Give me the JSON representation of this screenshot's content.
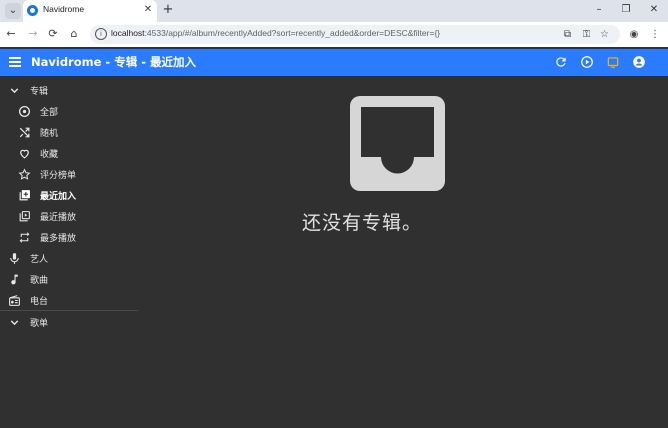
{
  "browser": {
    "tab_title": "Navidrome",
    "tab_close": "✕",
    "new_tab": "+",
    "url_host": "localhost",
    "url_rest": ":4533/app/#/album/recentlyAdded?sort=recently_added&order=DESC&filter={}",
    "window_minimize": "–",
    "window_restore": "❐",
    "window_close": "✕"
  },
  "appbar": {
    "title": "Navidrome - 专辑 - 最近加入"
  },
  "sidebar": {
    "albums_section": "专辑",
    "album_items": [
      {
        "label": "全部",
        "icon": "album-icon"
      },
      {
        "label": "随机",
        "icon": "shuffle-icon"
      },
      {
        "label": "收藏",
        "icon": "heart-icon"
      },
      {
        "label": "评分榜单",
        "icon": "star-icon"
      },
      {
        "label": "最近加入",
        "icon": "library-add-icon",
        "active": true
      },
      {
        "label": "最近播放",
        "icon": "library-play-icon"
      },
      {
        "label": "最多播放",
        "icon": "repeat-icon"
      }
    ],
    "top_items": [
      {
        "label": "艺人",
        "icon": "mic-icon"
      },
      {
        "label": "歌曲",
        "icon": "music-note-icon"
      },
      {
        "label": "电台",
        "icon": "radio-icon"
      }
    ],
    "playlists_section": "歌单"
  },
  "empty_state": {
    "message": "还没有专辑。",
    "icon": "inbox-icon"
  },
  "colors": {
    "appbar": "#2b7bff",
    "background": "#303030",
    "icon_fill": "#d6d6d6"
  }
}
